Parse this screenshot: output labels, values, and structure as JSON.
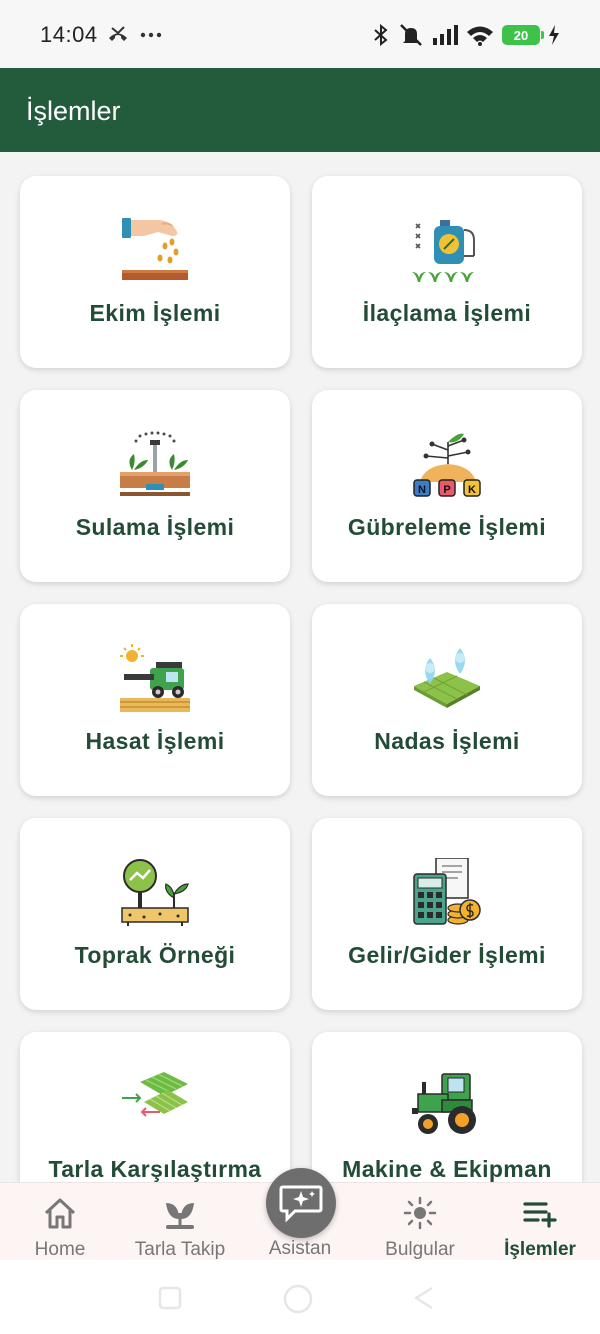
{
  "status": {
    "time": "14:04",
    "battery": "20"
  },
  "app": {
    "title": "İşlemler"
  },
  "cards": [
    {
      "label": "Ekim İşlemi"
    },
    {
      "label": "İlaçlama İşlemi"
    },
    {
      "label": "Sulama İşlemi"
    },
    {
      "label": "Gübreleme İşlemi"
    },
    {
      "label": "Hasat İşlemi"
    },
    {
      "label": "Nadas İşlemi"
    },
    {
      "label": "Toprak Örneği"
    },
    {
      "label": "Gelir/Gider İşlemi"
    },
    {
      "label": "Tarla Karşılaştırma"
    },
    {
      "label": "Makine & Ekipman"
    }
  ],
  "nav": {
    "home": "Home",
    "tarla_takip": "Tarla Takip",
    "asistan": "Asistan",
    "bulgular": "Bulgular",
    "islemler": "İşlemler"
  },
  "npk_letters": [
    "N",
    "P",
    "K"
  ]
}
